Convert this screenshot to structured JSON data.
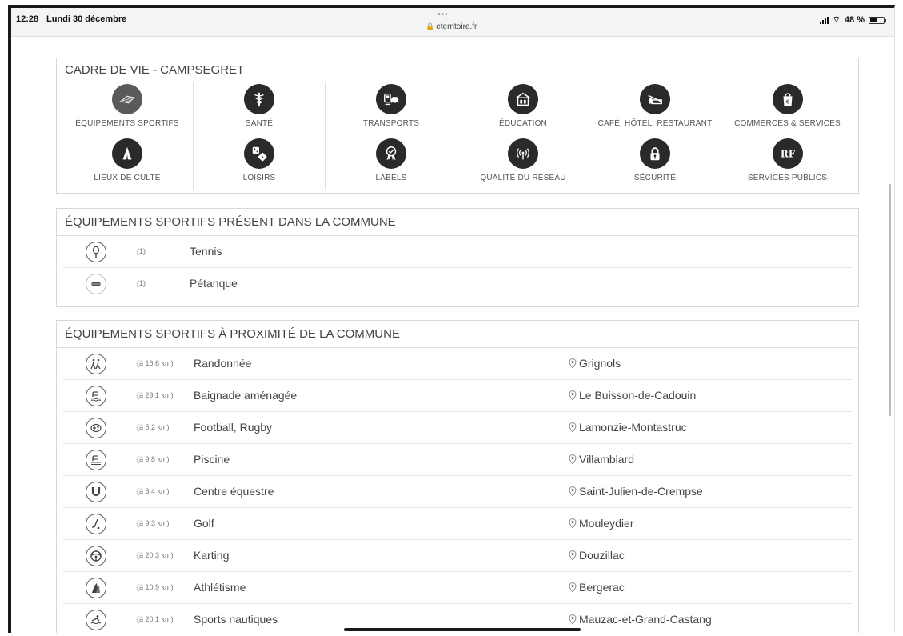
{
  "status_bar": {
    "time": "12:28",
    "date": "Lundi 30 décembre",
    "dots": "•••",
    "url": "eterritoire.fr",
    "battery": "48 %",
    "battery_level": 0.48
  },
  "cadre": {
    "title": "CADRE DE VIE - CAMPSEGRET",
    "categories": [
      {
        "label": "ÉQUIPEMENTS SPORTIFS",
        "icon": "sports-icon"
      },
      {
        "label": "SANTÉ",
        "icon": "caduceus-icon"
      },
      {
        "label": "TRANSPORTS",
        "icon": "train-car-icon"
      },
      {
        "label": "ÉDUCATION",
        "icon": "school-book-icon"
      },
      {
        "label": "CAFÉ, HÔTEL, RESTAURANT",
        "icon": "hotel-bed-icon"
      },
      {
        "label": "COMMERCES & SERVICES",
        "icon": "shopping-bag-euro-icon"
      },
      {
        "label": "LIEUX DE CULTE",
        "icon": "praying-hands-icon"
      },
      {
        "label": "LOISIRS",
        "icon": "dice-icon"
      },
      {
        "label": "LABELS",
        "icon": "award-ribbon-icon"
      },
      {
        "label": "QUALITÉ DU RÉSEAU",
        "icon": "antenna-signal-icon"
      },
      {
        "label": "SÉCURITÉ",
        "icon": "padlock-icon"
      },
      {
        "label": "SERVICES PUBLICS",
        "icon": "rf-monogram-icon"
      }
    ]
  },
  "present": {
    "title": "ÉQUIPEMENTS SPORTIFS PRÉSENT DANS LA COMMUNE",
    "items": [
      {
        "count": "(1)",
        "name": "Tennis",
        "icon": "tennis-racket-icon"
      },
      {
        "count": "(1)",
        "name": "Pétanque",
        "icon": "petanque-balls-icon"
      }
    ]
  },
  "proximity": {
    "title": "ÉQUIPEMENTS SPORTIFS À PROXIMITÉ DE LA COMMUNE",
    "items": [
      {
        "distance": "(à 16.6 km)",
        "activity": "Randonnée",
        "place": "Grignols",
        "icon": "hikers-icon"
      },
      {
        "distance": "(à 29.1 km)",
        "activity": "Baignade aménagée",
        "place": "Le Buisson-de-Cadouin",
        "icon": "swimmer-icon"
      },
      {
        "distance": "(à 5.2 km)",
        "activity": "Football, Rugby",
        "place": "Lamonzie-Montastruc",
        "icon": "ball-icon"
      },
      {
        "distance": "(à 9.8 km)",
        "activity": "Piscine",
        "place": "Villamblard",
        "icon": "pool-icon"
      },
      {
        "distance": "(à 3.4 km)",
        "activity": "Centre équestre",
        "place": "Saint-Julien-de-Crempse",
        "icon": "horseshoe-icon"
      },
      {
        "distance": "(à 9.3 km)",
        "activity": "Golf",
        "place": "Mouleydier",
        "icon": "golf-icon"
      },
      {
        "distance": "(à 20.3 km)",
        "activity": "Karting",
        "place": "Douzillac",
        "icon": "steering-wheel-icon"
      },
      {
        "distance": "(à 10.9 km)",
        "activity": "Athlétisme",
        "place": "Bergerac",
        "icon": "running-track-icon"
      },
      {
        "distance": "(à 20.1 km)",
        "activity": "Sports nautiques",
        "place": "Mauzac-et-Grand-Castang",
        "icon": "water-sports-icon"
      }
    ]
  },
  "colors": {
    "icon_bg": "#2a2a2a",
    "border": "#d8d8d8",
    "text": "#444444"
  }
}
